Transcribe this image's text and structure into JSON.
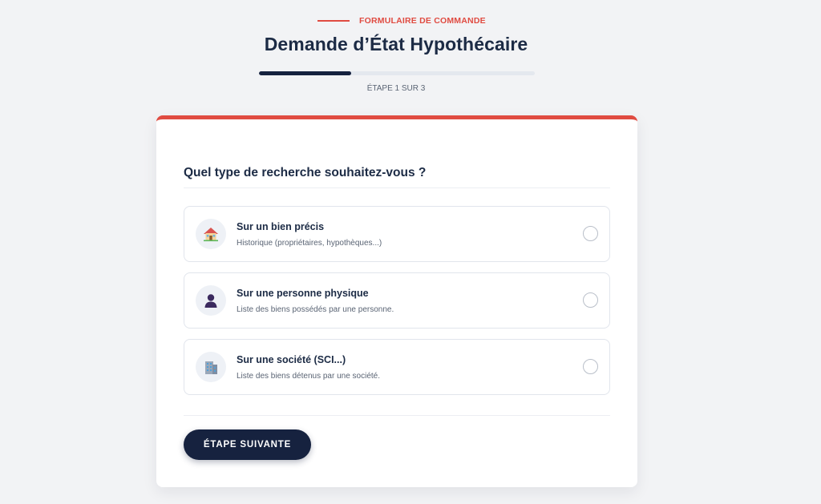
{
  "header": {
    "eyebrow": "FORMULAIRE DE COMMANDE",
    "title": "Demande d’État Hypothécaire",
    "progress_fraction": 0.333,
    "step_label": "ÉTAPE 1 SUR 3"
  },
  "form": {
    "question": "Quel type de recherche souhaitez-vous ?",
    "options": [
      {
        "title": "Sur un bien précis",
        "description": "Historique (propriétaires, hypothèques...)",
        "icon": "house-icon",
        "selected": false
      },
      {
        "title": "Sur une personne physique",
        "description": "Liste des biens possédés par une personne.",
        "icon": "person-icon",
        "selected": false
      },
      {
        "title": "Sur une société (SCI...)",
        "description": "Liste des biens détenus par une société.",
        "icon": "office-building-icon",
        "selected": false
      }
    ],
    "next_button": "ÉTAPE SUIVANTE"
  },
  "colors": {
    "accent": "#e04b41",
    "navy": "#16223f",
    "text": "#1c2b45",
    "background": "#f2f3f5"
  }
}
